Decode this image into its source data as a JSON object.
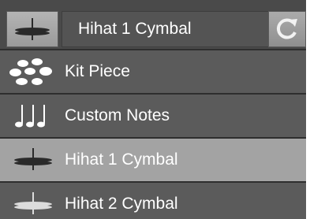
{
  "header": {
    "selected_label": "Hihat 1 Cymbal",
    "icon": "hihat-cymbal-icon",
    "refresh_icon": "refresh-icon"
  },
  "menu": {
    "items": [
      {
        "label": "Kit Piece",
        "icon": "kit-piece-icon"
      },
      {
        "label": "Custom Notes",
        "icon": "music-notes-icon"
      },
      {
        "label": "Hihat 1 Cymbal",
        "icon": "hihat-cymbal-icon",
        "selected": true
      },
      {
        "label": "Hihat 2 Cymbal",
        "icon": "hihat-cymbal-icon"
      }
    ]
  },
  "colors": {
    "panel_bg": "#454545",
    "item_bg": "#5b5b5b",
    "selected_bg": "#a3a3a3",
    "text": "#ffffff"
  }
}
